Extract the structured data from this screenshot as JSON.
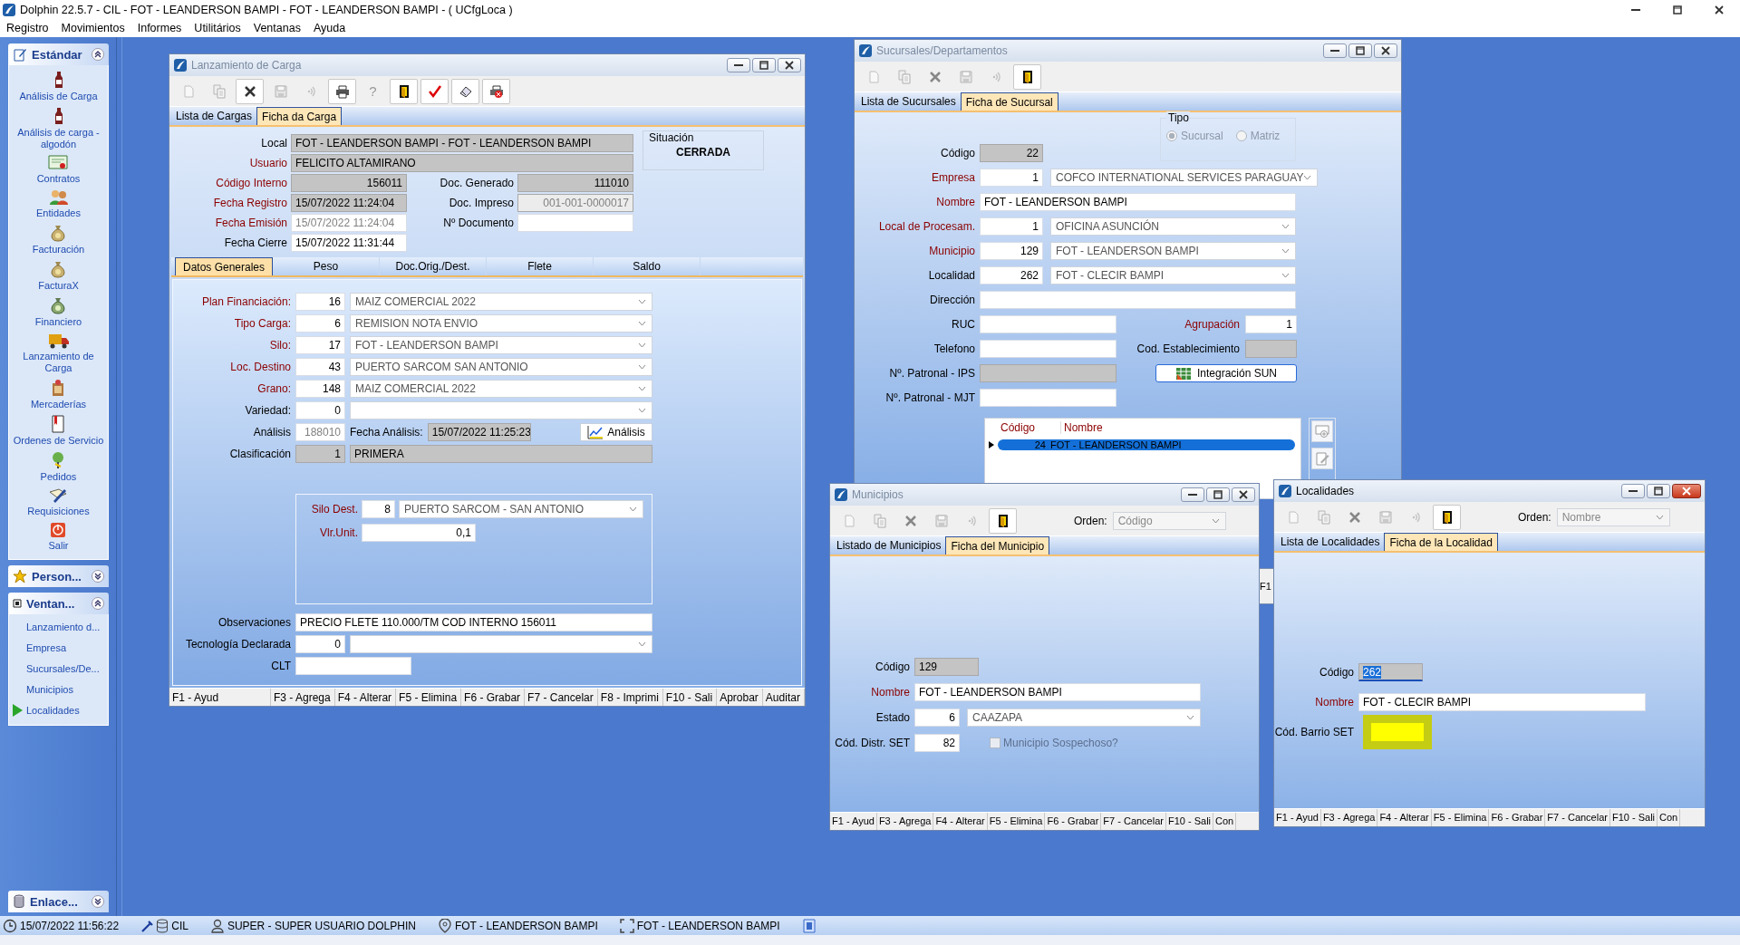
{
  "app": {
    "title": "Dolphin 22.5.7 - CIL - FOT - LEANDERSON BAMPI - FOT - LEANDERSON BAMPI -  ( UCfgLoca )",
    "menu": [
      "Registro",
      "Movimientos",
      "Informes",
      "Utilitários",
      "Ventanas",
      "Ayuda"
    ]
  },
  "sidebar": {
    "groups": [
      {
        "kind": "icons",
        "title": "Estándar",
        "expanded": true,
        "items": [
          {
            "label": "Análisis de Carga"
          },
          {
            "label": "Análisis de carga - algodón"
          },
          {
            "label": "Contratos"
          },
          {
            "label": "Entidades"
          },
          {
            "label": "Facturación"
          },
          {
            "label": "FacturaX"
          },
          {
            "label": "Financiero"
          },
          {
            "label": "Lanzamiento de Carga"
          },
          {
            "label": "Mercaderías"
          },
          {
            "label": "Ordenes de Servicio"
          },
          {
            "label": "Pedidos"
          },
          {
            "label": "Requisiciones"
          },
          {
            "label": "Salir"
          }
        ]
      },
      {
        "title": "Person...",
        "expanded": false
      },
      {
        "kind": "list",
        "title": "Ventan...",
        "expanded": true,
        "items": [
          {
            "label": "Lanzamiento d...",
            "selected": false
          },
          {
            "label": "Empresa",
            "selected": false
          },
          {
            "label": "Sucursales/De...",
            "selected": false
          },
          {
            "label": "Municipios",
            "selected": false
          },
          {
            "label": "Localidades",
            "selected": true
          }
        ]
      },
      {
        "title": "Enlace...",
        "expanded": false
      }
    ]
  },
  "windows": [
    {
      "kind": "lanzamiento",
      "title": "Lanzamiento de Carga",
      "active": false,
      "toolbar": [
        {
          "kind": "new",
          "disabled": true
        },
        {
          "kind": "copy",
          "disabled": true
        },
        {
          "kind": "delete",
          "disabled": false
        },
        {
          "kind": "save",
          "disabled": true
        },
        {
          "kind": "wave",
          "disabled": true
        },
        {
          "kind": "print",
          "disabled": false
        },
        {
          "kind": "help",
          "glyph": "?",
          "disabled": true
        },
        {
          "kind": "exit",
          "disabled": false
        },
        {
          "kind": "check",
          "disabled": false
        },
        {
          "kind": "eraser",
          "disabled": false
        },
        {
          "kind": "printstop",
          "disabled": false
        }
      ],
      "tabs": [
        {
          "label": "Lista de Cargas",
          "selected": false
        },
        {
          "label": "Ficha da Carga",
          "selected": true
        }
      ],
      "header_fields": [
        {
          "kind": "wide",
          "label": "Local",
          "required": false,
          "value": "FOT - LEANDERSON BAMPI - FOT - LEANDERSON BAMPI",
          "readonly": true,
          "disabled": false
        },
        {
          "kind": "wide",
          "label": "Usuario",
          "required": true,
          "value": "FELICITO ALTAMIRANO",
          "readonly": true,
          "disabled": false
        },
        {
          "kind": "number",
          "label": "Código Interno",
          "required": true,
          "value": "156011",
          "readonly": true,
          "disabled": false
        },
        {
          "kind": "number",
          "label": "Doc. Generado",
          "required": false,
          "value": "111010",
          "readonly": true,
          "disabled": false
        },
        {
          "kind": "text",
          "label": "Fecha Registro",
          "required": true,
          "value": "15/07/2022 11:24:04",
          "readonly": true,
          "disabled": false
        },
        {
          "kind": "number",
          "label": "Doc. Impreso",
          "required": false,
          "value": "001-001-0000017",
          "readonly": true,
          "disabled": true
        },
        {
          "kind": "text",
          "label": "Fecha Emisión",
          "required": true,
          "value": "15/07/2022 11:24:04",
          "readonly": false,
          "disabled": true
        },
        {
          "kind": "number",
          "label": "Nº Documento",
          "required": false,
          "readonly": false
        },
        {
          "kind": "text",
          "label": "Fecha Cierre",
          "required": false,
          "value": "15/07/2022 11:31:44",
          "readonly": false,
          "disabled": false
        }
      ],
      "situacion": {
        "label": "Situación",
        "value": "CERRADA"
      },
      "inner_tabs": [
        {
          "label": "Datos Generales",
          "selected": true
        },
        {
          "label": "Peso",
          "selected": false
        },
        {
          "label": "Doc.Orig./Dest.",
          "selected": false
        },
        {
          "label": "Flete",
          "selected": false
        },
        {
          "label": "Saldo",
          "selected": false
        }
      ],
      "detail_rows": [
        {
          "kind": "combo",
          "label": "Plan Financiación:",
          "required": true,
          "code": "16",
          "value": "MAIZ COMERCIAL 2022"
        },
        {
          "kind": "combo",
          "label": "Tipo Carga:",
          "required": true,
          "code": "6",
          "value": "REMISION NOTA ENVIO"
        },
        {
          "kind": "combo",
          "label": "Silo:",
          "required": true,
          "code": "17",
          "value": "FOT - LEANDERSON BAMPI"
        },
        {
          "kind": "combo",
          "label": "Loc. Destino",
          "required": true,
          "code": "43",
          "value": "PUERTO SARCOM SAN ANTONIO"
        },
        {
          "kind": "combo",
          "label": "Grano:",
          "required": true,
          "code": "148",
          "value": "MAIZ COMERCIAL 2022"
        },
        {
          "kind": "combo",
          "label": "Variedad:",
          "required": false,
          "code": "0"
        },
        {
          "kind": "analysis",
          "label": "Análisis",
          "required": false,
          "code": "188010",
          "date_label": "Fecha Análisis:",
          "date": "15/07/2022 11:25:23",
          "button": "Análisis"
        },
        {
          "kind": "locked",
          "label": "Clasificación",
          "required": false,
          "code": "1",
          "value": "PRIMERA"
        },
        {
          "kind": "group",
          "rows": [
            {
              "kind": "combo",
              "label": "Silo Dest.",
              "required": true,
              "code": "8",
              "value": "PUERTO SARCOM - SAN ANTONIO"
            },
            {
              "kind": "number",
              "label": "Vlr.Unit.",
              "required": true,
              "value": "0,1"
            }
          ]
        },
        {
          "kind": "text",
          "label": "Observaciones",
          "required": false,
          "value": "PRECIO FLETE 110.000/TM COD INTERNO 156011"
        },
        {
          "kind": "combo",
          "label": "Tecnología Declarada",
          "required": false,
          "code": "0"
        },
        {
          "kind": "short",
          "label": "CLT",
          "required": false
        }
      ],
      "function_keys": [
        "F1 - Ayud",
        "F3 - Agrega",
        "F4 - Alterar",
        "F5 - Elimina",
        "F6 - Grabar",
        "F7 - Cancelar",
        "F8 - Imprimi",
        "F10 - Sali",
        "Aprobar",
        "Auditar"
      ]
    },
    {
      "kind": "sucursales",
      "title": "Sucursales/Departamentos",
      "active": false,
      "toolbar": [
        {
          "kind": "new",
          "disabled": true
        },
        {
          "kind": "copy",
          "disabled": true
        },
        {
          "kind": "delete",
          "disabled": true
        },
        {
          "kind": "save",
          "disabled": true
        },
        {
          "kind": "wave",
          "disabled": true
        },
        {
          "kind": "exit",
          "disabled": false
        }
      ],
      "tabs": [
        {
          "label": "Lista de Sucursales",
          "selected": false
        },
        {
          "label": "Ficha de Sucursal",
          "selected": true
        }
      ],
      "tipo": {
        "label": "Tipo",
        "options": [
          {
            "label": "Sucursal",
            "selected": true
          },
          {
            "label": "Matriz",
            "selected": false
          }
        ]
      },
      "fields": [
        {
          "kind": "code",
          "label": "Código",
          "required": false,
          "value": "22",
          "readonly": true
        },
        {
          "kind": "code_combo",
          "label": "Empresa",
          "required": true,
          "code": "1",
          "value": "COFCO INTERNATIONAL SERVICES PARAGUAY"
        },
        {
          "kind": "text",
          "label": "Nombre",
          "required": true,
          "value": "FOT - LEANDERSON BAMPI"
        },
        {
          "kind": "code_combo",
          "label": "Local de Procesam.",
          "required": true,
          "code": "1",
          "value": "OFICINA ASUNCIÓN"
        },
        {
          "kind": "code_combo",
          "label": "Municipio",
          "required": true,
          "code": "129",
          "value": "FOT - LEANDERSON BAMPI"
        },
        {
          "kind": "code_combo",
          "label": "Localidad",
          "required": false,
          "code": "262",
          "value": "FOT - CLECIR BAMPI"
        },
        {
          "kind": "text",
          "label": "Dirección",
          "required": false
        },
        {
          "kind": "medium",
          "label": "RUC",
          "required": false,
          "right": {
            "label": "Agrupación",
            "required": true,
            "value": "1",
            "readonly": false
          }
        },
        {
          "kind": "medium",
          "label": "Telefono",
          "required": false,
          "right": {
            "label": "Cod. Establecimiento",
            "required": false,
            "readonly": true
          }
        },
        {
          "kind": "medium",
          "label": "Nº. Patronal - IPS",
          "required": false,
          "readonly": true,
          "button": "Integración SUN"
        },
        {
          "kind": "medium",
          "label": "Nº. Patronal - MJT",
          "required": false
        }
      ],
      "grid": {
        "columns": [
          "Código",
          "Nombre"
        ],
        "rows": [
          {
            "cells": [
              "24",
              "FOT - LEANDERSON BAMPI"
            ],
            "selected": true
          }
        ]
      }
    },
    {
      "kind": "fragment",
      "text": "F1"
    },
    {
      "kind": "ficha",
      "title": "Municipios",
      "active": false,
      "toolbar": [
        {
          "kind": "new",
          "disabled": true
        },
        {
          "kind": "copy",
          "disabled": true
        },
        {
          "kind": "delete",
          "disabled": true
        },
        {
          "kind": "save",
          "disabled": true
        },
        {
          "kind": "wave",
          "disabled": true
        },
        {
          "kind": "exit",
          "disabled": false
        }
      ],
      "orden": {
        "label": "Orden:",
        "value": "Código"
      },
      "tabs": [
        {
          "label": "Listado de Municipios",
          "selected": false
        },
        {
          "label": "Ficha del Municipio",
          "selected": true
        }
      ],
      "fields": [
        {
          "kind": "code",
          "label": "Código",
          "required": false,
          "value": "129",
          "readonly": true
        },
        {
          "kind": "text",
          "label": "Nombre",
          "required": true,
          "value": "FOT - LEANDERSON BAMPI"
        },
        {
          "kind": "code_combo",
          "label": "Estado",
          "required": false,
          "code": "6",
          "value": "CAAZAPA"
        },
        {
          "kind": "code_check",
          "label": "Cód. Distr. SET",
          "required": false,
          "code": "82",
          "check": {
            "label": "Municipio Sospechoso?",
            "checked": false
          }
        }
      ],
      "function_keys": [
        "F1 - Ayud",
        "F3 - Agrega",
        "F4 - Alterar",
        "F5 - Elimina",
        "F6 - Grabar",
        "F7 - Cancelar",
        "F10 - Sali",
        "Con"
      ]
    },
    {
      "kind": "ficha",
      "title": "Localidades",
      "active": true,
      "toolbar": [
        {
          "kind": "new",
          "disabled": true
        },
        {
          "kind": "copy",
          "disabled": true
        },
        {
          "kind": "delete",
          "disabled": true
        },
        {
          "kind": "save",
          "disabled": true
        },
        {
          "kind": "wave",
          "disabled": true
        },
        {
          "kind": "exit",
          "disabled": false
        }
      ],
      "orden": {
        "label": "Orden:",
        "value": "Nombre"
      },
      "tabs": [
        {
          "label": "Lista de Localidades",
          "selected": false
        },
        {
          "label": "Ficha de la Localidad",
          "selected": true
        }
      ],
      "fields": [
        {
          "kind": "code",
          "label": "Código",
          "required": false,
          "value": "262",
          "readonly": true,
          "text_selected": true
        },
        {
          "kind": "text",
          "label": "Nombre",
          "required": true,
          "value": "FOT - CLECIR BAMPI"
        },
        {
          "kind": "code",
          "label": "Cód. Barrio SET",
          "required": false,
          "highlighted": true
        }
      ],
      "function_keys": [
        "F1 - Ayud",
        "F3 - Agrega",
        "F4 - Alterar",
        "F5 - Elimina",
        "F6 - Grabar",
        "F7 - Cancelar",
        "F10 - Sali",
        "Con"
      ]
    }
  ],
  "status_bar": [
    {
      "kind": "clock",
      "text": "15/07/2022 11:56:22"
    },
    {
      "kind": "database",
      "text": "CIL"
    },
    {
      "kind": "user",
      "text": "SUPER - SUPER USUARIO DOLPHIN"
    },
    {
      "kind": "location",
      "text": "FOT - LEANDERSON BAMPI"
    },
    {
      "kind": "frame",
      "text": "FOT - LEANDERSON BAMPI"
    },
    {
      "kind": "help"
    }
  ]
}
